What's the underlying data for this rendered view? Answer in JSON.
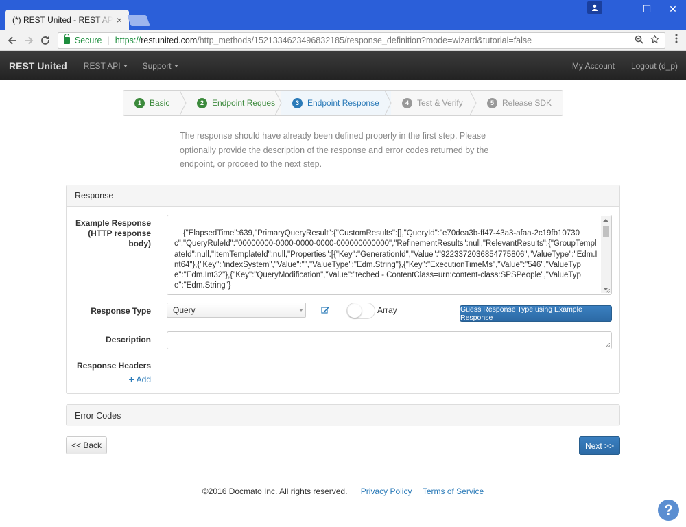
{
  "browser": {
    "tab_title": "(*) REST United - REST API n",
    "tab_close": "×",
    "secure_label": "Secure",
    "url_scheme": "https://",
    "url_domain": "restunited.com",
    "url_path": "/http_methods/1521334623496832185/response_definition?mode=wizard&tutorial=false",
    "icons": [
      "back-icon",
      "forward-icon",
      "reload-icon",
      "lock-icon",
      "zoom-icon",
      "star-icon",
      "menu-icon"
    ]
  },
  "window_controls": {
    "minimize": "—",
    "maximize": "☐",
    "close": "✕"
  },
  "navbar": {
    "brand": "REST United",
    "rest_api": "REST API",
    "support": "Support",
    "my_account": "My Account",
    "logout": "Logout (d_p)"
  },
  "wizard": {
    "steps": [
      {
        "num": "1",
        "label": "Basic",
        "state": "done"
      },
      {
        "num": "2",
        "label": "Endpoint Request",
        "state": "done"
      },
      {
        "num": "3",
        "label": "Endpoint Response",
        "state": "active"
      },
      {
        "num": "4",
        "label": "Test & Verify",
        "state": "todo"
      },
      {
        "num": "5",
        "label": "Release SDK",
        "state": "todo"
      }
    ]
  },
  "intro_text": "The response should have already been defined properly in the first step. Please optionally provide the description of the response and error codes returned by the endpoint, or proceed to the next step.",
  "response_panel": {
    "heading": "Response",
    "example_label": "Example Response (HTTP response body)",
    "example_value": "{\"ElapsedTime\":639,\"PrimaryQueryResult\":{\"CustomResults\":[],\"QueryId\":\"e70dea3b-ff47-43a3-afaa-2c19fb10730c\",\"QueryRuleId\":\"00000000-0000-0000-0000-000000000000\",\"RefinementResults\":null,\"RelevantResults\":{\"GroupTemplateId\":null,\"ItemTemplateId\":null,\"Properties\":[{\"Key\":\"GenerationId\",\"Value\":\"9223372036854775806\",\"ValueType\":\"Edm.Int64\"},{\"Key\":\"indexSystem\",\"Value\":\"\",\"ValueType\":\"Edm.String\"},{\"Key\":\"ExecutionTimeMs\",\"Value\":\"546\",\"ValueType\":\"Edm.Int32\"},{\"Key\":\"QueryModification\",\"Value\":\"teched - ContentClass=urn:content-class:SPSPeople\",\"ValueType\":\"Edm.String\"}",
    "response_type_label": "Response Type",
    "response_type_value": "Query",
    "array_label": "Array",
    "array_enabled": false,
    "guess_button": "Guess Response Type using Example Response",
    "description_label": "Description",
    "description_value": "",
    "headers_label": "Response Headers",
    "add_label": "Add"
  },
  "error_panel": {
    "heading": "Error Codes"
  },
  "actions": {
    "back": "<< Back",
    "next": "Next >>"
  },
  "footer": {
    "copyright": "©2016 Docmato Inc. All rights reserved.",
    "privacy": "Privacy Policy",
    "terms": "Terms of Service"
  },
  "help": "?",
  "colors": {
    "titlebar": "#2b5fd9",
    "navbar": "#2b2b2b",
    "done_step": "#3c8a3c",
    "active_step": "#2a7ab8",
    "primary_button": "#337ab7",
    "link": "#2a7ab8"
  }
}
